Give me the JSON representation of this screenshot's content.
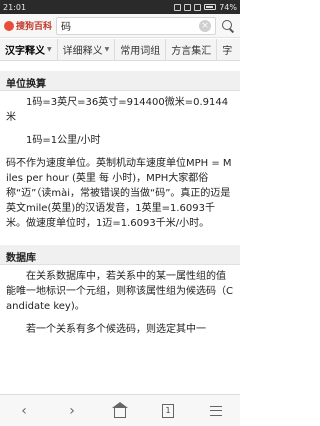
{
  "statusbar": {
    "time": "21:01",
    "battery": "74%"
  },
  "search": {
    "logo": "搜狗百科",
    "query": "码",
    "clear": "×"
  },
  "tabs": [
    {
      "label": "汉字释义",
      "active": true
    },
    {
      "label": "详细释义",
      "active": false
    },
    {
      "label": "常用词组",
      "active": false
    },
    {
      "label": "方言集汇",
      "active": false
    },
    {
      "label": "字",
      "active": false
    }
  ],
  "sections": {
    "unit": {
      "title": "单位换算",
      "p1": "1码=3英尺=36英寸=914400微米=0.9144米",
      "p2": "1码=1公里/小时",
      "p3": "码不作为速度单位。英制机动车速度单位MPH = Miles per hour (英里 每 小时)，MPH大家都俗称“迈”（读mài，常被错误的当做“码”。真正的迈是英文mile(英里)的汉语发音，1英里=1.6093千米。做速度单位时，1迈=1.6093千米/小时。"
    },
    "database": {
      "title": "数据库",
      "p1": "在关系数据库中，若关系中的某一属性组的值能唯一地标识一个元组，则称该属性组为候选码（Candidate key)。",
      "p2": "若一个关系有多个候选码，则选定其中一"
    }
  },
  "bottombar": {
    "page_count": "1"
  }
}
